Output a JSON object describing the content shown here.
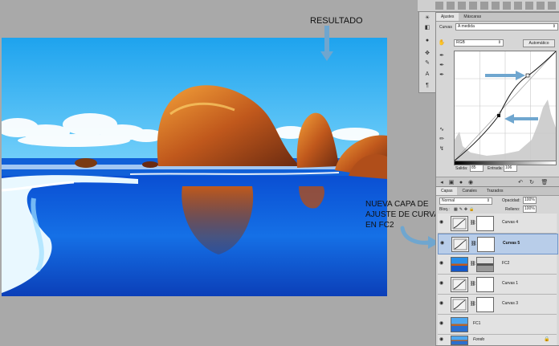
{
  "annotations": {
    "resultado": "RESULTADO",
    "nueva_capa": [
      "NUEVA CAPA DE",
      "AJUSTE DE CURVAS",
      "EN FC2"
    ]
  },
  "adjust_panel": {
    "tabs": [
      "Ajustes",
      "Máscaras"
    ],
    "preset_label": "Curvas",
    "preset_value": "A medida",
    "channel": "RGB",
    "auto_button": "Automático",
    "output_label": "Salida:",
    "output_value": "85",
    "input_label": "Entrada:",
    "input_value": "106"
  },
  "layers_panel": {
    "tabs": [
      "Capas",
      "Canales",
      "Trazados"
    ],
    "blend_mode": "Normal",
    "opacity_label": "Opacidad:",
    "opacity_value": "100%",
    "lock_label": "Bloq.:",
    "fill_label": "Relleno:",
    "fill_value": "100%",
    "layers": [
      {
        "name": "Curvas 4",
        "type": "adjustment",
        "selected": false
      },
      {
        "name": "Curvas 5",
        "type": "adjustment",
        "selected": true
      },
      {
        "name": "FC2",
        "type": "image-mask",
        "selected": false
      },
      {
        "name": "Curvas 1",
        "type": "adjustment",
        "selected": false
      },
      {
        "name": "Curvas 3",
        "type": "adjustment",
        "selected": false
      },
      {
        "name": "FC1",
        "type": "image",
        "selected": false
      },
      {
        "name": "Fondo",
        "type": "background",
        "selected": false
      }
    ]
  },
  "colors": {
    "annotation_arrow": "#6fa6cf",
    "selected_layer": "#b8cde9"
  }
}
